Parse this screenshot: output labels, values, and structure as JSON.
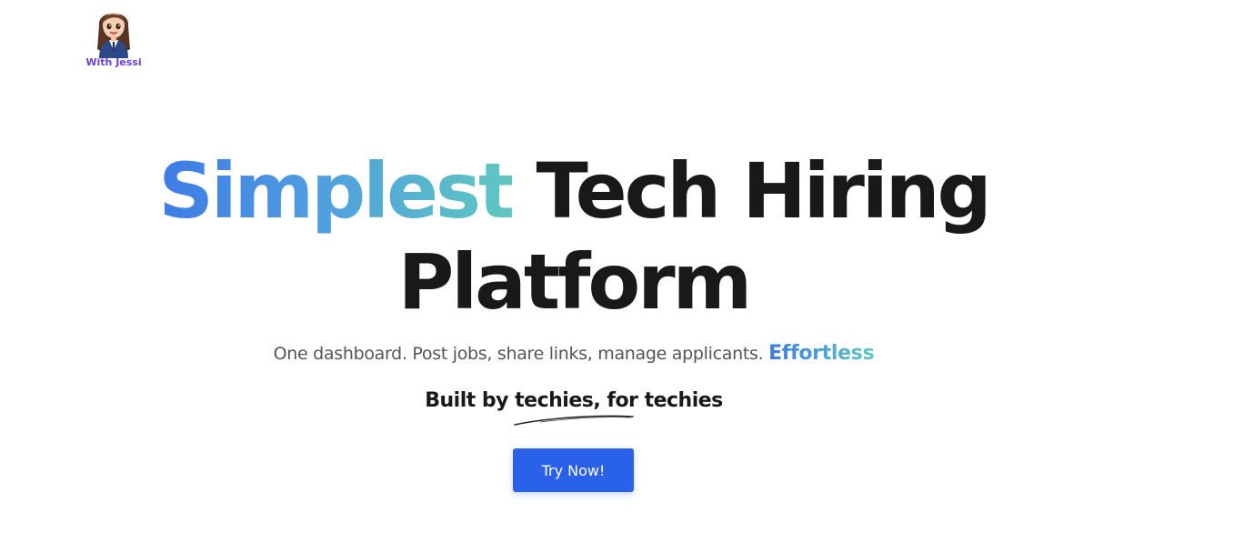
{
  "logo": {
    "caption": "With Jessi",
    "icon": "avatar-icon",
    "caption_color": "#6d3fd6"
  },
  "hero": {
    "title_highlight": "Simplest",
    "title_rest_line1": "Tech Hiring",
    "title_line2": "Platform",
    "gradient_colors": [
      "#3f7ae6",
      "#5fc7c0"
    ]
  },
  "subtitle": {
    "text": "One dashboard. Post jobs, share links, manage applicants.",
    "highlight": "Effortless"
  },
  "tagline": {
    "text": "Built by techies, for techies"
  },
  "cta": {
    "label": "Try Now!",
    "color": "#2962e8"
  }
}
